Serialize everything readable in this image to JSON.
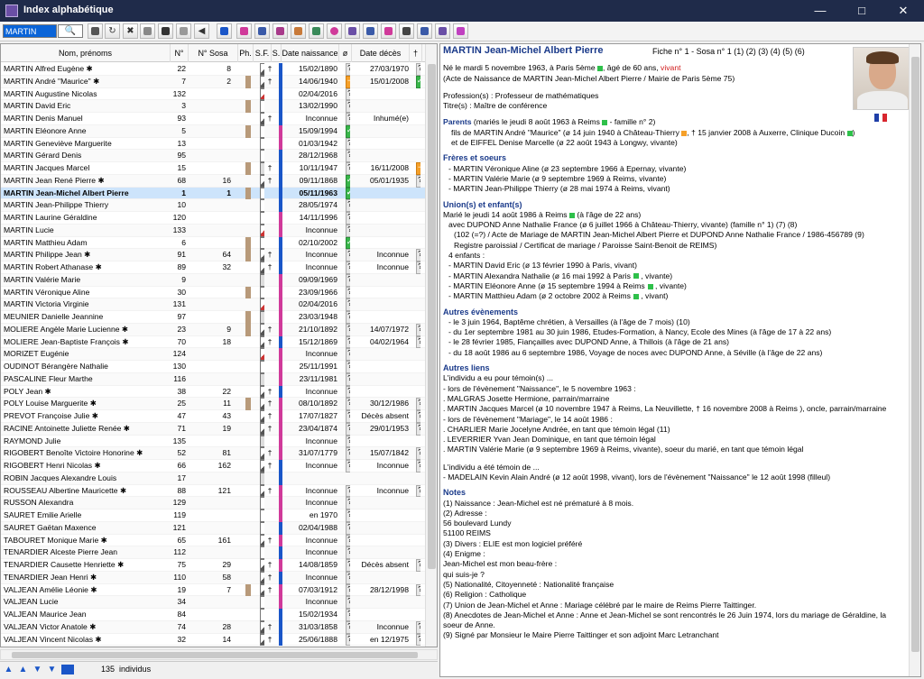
{
  "window": {
    "title": "Index alphabétique",
    "minimize": "—",
    "maximize": "□",
    "close": "✕"
  },
  "search": {
    "value": "MARTIN"
  },
  "columns": {
    "name": "Nom, prénoms",
    "n": "N°",
    "nsosa": "N° Sosa",
    "ph": "Ph.",
    "sf": "S.F.",
    "s": "S.",
    "birth": "Date naissance",
    "q1": "ø",
    "death": "Date décès",
    "q2": "†"
  },
  "rows": [
    {
      "name": "MARTIN Alfred Eugène ✱",
      "n": "22",
      "sosa": "8",
      "ph": false,
      "sf": "g",
      "cr": "†",
      "sx": "m",
      "birth": "15/02/1890",
      "q1": "?",
      "death": "27/03/1970",
      "q2": "?"
    },
    {
      "name": "MARTIN André \"Maurice\" ✱",
      "n": "7",
      "sosa": "2",
      "ph": true,
      "sf": "g",
      "cr": "†",
      "sx": "m",
      "birth": "14/06/1940",
      "q1": "or",
      "death": "15/01/2008",
      "q2": "ok"
    },
    {
      "name": "MARTIN Augustine Nicolas",
      "n": "132",
      "sosa": "",
      "ph": false,
      "sf": "r",
      "cr": "",
      "sx": "m",
      "birth": "02/04/2016",
      "q1": "?",
      "death": "",
      "q2": ""
    },
    {
      "name": "MARTIN David Eric",
      "n": "3",
      "sosa": "",
      "ph": true,
      "sf": "",
      "cr": "",
      "sx": "m",
      "birth": "13/02/1990",
      "q1": "?",
      "death": "",
      "q2": ""
    },
    {
      "name": "MARTIN Denis Manuel",
      "n": "93",
      "sosa": "",
      "ph": false,
      "sf": "g",
      "cr": "†",
      "sx": "m",
      "birth": "Inconnue",
      "q1": "?",
      "death": "Inhumé(e)",
      "q2": ""
    },
    {
      "name": "MARTIN Eléonore Anne",
      "n": "5",
      "sosa": "",
      "ph": true,
      "sf": "",
      "cr": "",
      "sx": "f",
      "birth": "15/09/1994",
      "q1": "ok",
      "death": "",
      "q2": ""
    },
    {
      "name": "MARTIN Geneviève Marguerite",
      "n": "13",
      "sosa": "",
      "ph": false,
      "sf": "",
      "cr": "",
      "sx": "f",
      "birth": "01/03/1942",
      "q1": "?",
      "death": "",
      "q2": ""
    },
    {
      "name": "MARTIN Gérard Denis",
      "n": "95",
      "sosa": "",
      "ph": false,
      "sf": "",
      "cr": "",
      "sx": "m",
      "birth": "28/12/1968",
      "q1": "?",
      "death": "",
      "q2": ""
    },
    {
      "name": "MARTIN Jacques Marcel",
      "n": "15",
      "sosa": "",
      "ph": true,
      "sf": "x",
      "cr": "†",
      "sx": "m",
      "birth": "10/11/1947",
      "q1": "?",
      "death": "16/11/2008",
      "q2": "or"
    },
    {
      "name": "MARTIN Jean René Pierre ✱",
      "n": "68",
      "sosa": "16",
      "ph": false,
      "sf": "g",
      "cr": "†",
      "sx": "m",
      "birth": "09/11/1868",
      "q1": "ok",
      "death": "05/01/1935",
      "q2": "?"
    },
    {
      "name": "MARTIN Jean-Michel Albert Pierre",
      "n": "1",
      "sosa": "1",
      "ph": true,
      "sf": "",
      "cr": "",
      "sx": "m",
      "birth": "05/11/1963",
      "q1": "ok",
      "death": "",
      "q2": "",
      "sel": true
    },
    {
      "name": "MARTIN Jean-Philippe Thierry",
      "n": "10",
      "sosa": "",
      "ph": false,
      "sf": "",
      "cr": "",
      "sx": "m",
      "birth": "28/05/1974",
      "q1": "?",
      "death": "",
      "q2": ""
    },
    {
      "name": "MARTIN Laurine Géraldine",
      "n": "120",
      "sosa": "",
      "ph": false,
      "sf": "",
      "cr": "",
      "sx": "f",
      "birth": "14/11/1996",
      "q1": "?",
      "death": "",
      "q2": ""
    },
    {
      "name": "MARTIN Lucie",
      "n": "133",
      "sosa": "",
      "ph": false,
      "sf": "r",
      "cr": "",
      "sx": "f",
      "birth": "Inconnue",
      "q1": "?",
      "death": "",
      "q2": ""
    },
    {
      "name": "MARTIN Matthieu Adam",
      "n": "6",
      "sosa": "",
      "ph": true,
      "sf": "",
      "cr": "",
      "sx": "m",
      "birth": "02/10/2002",
      "q1": "ok",
      "death": "",
      "q2": ""
    },
    {
      "name": "MARTIN Philippe Jean ✱",
      "n": "91",
      "sosa": "64",
      "ph": true,
      "sf": "g",
      "cr": "†",
      "sx": "m",
      "birth": "Inconnue",
      "q1": "?",
      "death": "Inconnue",
      "q2": "?"
    },
    {
      "name": "MARTIN Robert Athanase ✱",
      "n": "89",
      "sosa": "32",
      "ph": false,
      "sf": "g",
      "cr": "†",
      "sx": "m",
      "birth": "Inconnue",
      "q1": "?",
      "death": "Inconnue",
      "q2": "?"
    },
    {
      "name": "MARTIN Valérie Marie",
      "n": "9",
      "sosa": "",
      "ph": false,
      "sf": "x",
      "cr": "",
      "sx": "f",
      "birth": "09/09/1969",
      "q1": "?",
      "death": "",
      "q2": ""
    },
    {
      "name": "MARTIN Véronique Aline",
      "n": "30",
      "sosa": "",
      "ph": true,
      "sf": "",
      "cr": "",
      "sx": "f",
      "birth": "23/09/1966",
      "q1": "?",
      "death": "",
      "q2": ""
    },
    {
      "name": "MARTIN Victoria Virginie",
      "n": "131",
      "sosa": "",
      "ph": false,
      "sf": "r",
      "cr": "",
      "sx": "f",
      "birth": "02/04/2016",
      "q1": "?",
      "death": "",
      "q2": ""
    },
    {
      "name": "MEUNIER Danielle Jeannine",
      "n": "97",
      "sosa": "",
      "ph": true,
      "sf": "x",
      "cr": "",
      "sx": "f",
      "birth": "23/03/1948",
      "q1": "?",
      "death": "",
      "q2": ""
    },
    {
      "name": "MOLIERE Angèle Marie Lucienne ✱",
      "n": "23",
      "sosa": "9",
      "ph": true,
      "sf": "g",
      "cr": "†",
      "sx": "f",
      "birth": "21/10/1892",
      "q1": "?",
      "death": "14/07/1972",
      "q2": "?"
    },
    {
      "name": "MOLIERE Jean-Baptiste François ✱",
      "n": "70",
      "sosa": "18",
      "ph": false,
      "sf": "g",
      "cr": "†",
      "sx": "m",
      "birth": "15/12/1869",
      "q1": "?",
      "death": "04/02/1964",
      "q2": "?"
    },
    {
      "name": "MORIZET Eugénie",
      "n": "124",
      "sosa": "",
      "ph": false,
      "sf": "r",
      "cr": "",
      "sx": "f",
      "birth": "Inconnue",
      "q1": "?",
      "death": "",
      "q2": ""
    },
    {
      "name": "OUDINOT Bérangère Nathalie",
      "n": "130",
      "sosa": "",
      "ph": false,
      "sf": "",
      "cr": "",
      "sx": "f",
      "birth": "25/11/1991",
      "q1": "?",
      "death": "",
      "q2": ""
    },
    {
      "name": "PASCALINE Fleur Marthe",
      "n": "116",
      "sosa": "",
      "ph": false,
      "sf": "x",
      "cr": "",
      "sx": "f",
      "birth": "23/11/1981",
      "q1": "?",
      "death": "",
      "q2": ""
    },
    {
      "name": "POLY Jean ✱",
      "n": "38",
      "sosa": "22",
      "ph": false,
      "sf": "g",
      "cr": "†",
      "sx": "m",
      "birth": "Inconnue",
      "q1": "?",
      "death": "",
      "q2": ""
    },
    {
      "name": "POLY Louise Marguerite ✱",
      "n": "25",
      "sosa": "11",
      "ph": true,
      "sf": "g",
      "cr": "†",
      "sx": "f",
      "birth": "08/10/1892",
      "q1": "?",
      "death": "30/12/1986",
      "q2": "?"
    },
    {
      "name": "PREVOT Françoise Julie ✱",
      "n": "47",
      "sosa": "43",
      "ph": false,
      "sf": "g",
      "cr": "†",
      "sx": "f",
      "birth": "17/07/1827",
      "q1": "?",
      "death": "Décès absent",
      "q2": "?"
    },
    {
      "name": "RACINE Antoinette Juliette Renée ✱",
      "n": "71",
      "sosa": "19",
      "ph": false,
      "sf": "g",
      "cr": "†",
      "sx": "f",
      "birth": "23/04/1874",
      "q1": "?",
      "death": "29/01/1953",
      "q2": "?"
    },
    {
      "name": "RAYMOND Julie",
      "n": "135",
      "sosa": "",
      "ph": false,
      "sf": "x",
      "cr": "",
      "sx": "f",
      "birth": "Inconnue",
      "q1": "?",
      "death": "",
      "q2": ""
    },
    {
      "name": "RIGOBERT Benoîte Victoire Honorine ✱",
      "n": "52",
      "sosa": "81",
      "ph": false,
      "sf": "g",
      "cr": "†",
      "sx": "f",
      "birth": "31/07/1779",
      "q1": "?",
      "death": "15/07/1842",
      "q2": "?"
    },
    {
      "name": "RIGOBERT Henri Nicolas ✱",
      "n": "66",
      "sosa": "162",
      "ph": false,
      "sf": "g",
      "cr": "†",
      "sx": "m",
      "birth": "Inconnue",
      "q1": "?",
      "death": "Inconnue",
      "q2": "?"
    },
    {
      "name": "ROBIN Jacques Alexandre Louis",
      "n": "17",
      "sosa": "",
      "ph": false,
      "sf": "x",
      "cr": "",
      "sx": "m",
      "birth": "",
      "q1": "",
      "death": "",
      "q2": ""
    },
    {
      "name": "ROUSSEAU Albertine Mauricette ✱",
      "n": "88",
      "sosa": "121",
      "ph": false,
      "sf": "g",
      "cr": "†",
      "sx": "f",
      "birth": "Inconnue",
      "q1": "?",
      "death": "Inconnue",
      "q2": "?"
    },
    {
      "name": "RUSSON Alexandra",
      "n": "129",
      "sosa": "",
      "ph": false,
      "sf": "",
      "cr": "",
      "sx": "f",
      "birth": "Inconnue",
      "q1": "?",
      "death": "",
      "q2": ""
    },
    {
      "name": "SAURET Emilie Arielle",
      "n": "119",
      "sosa": "",
      "ph": false,
      "sf": "",
      "cr": "",
      "sx": "f",
      "birth": "en 1970",
      "q1": "?",
      "death": "",
      "q2": ""
    },
    {
      "name": "SAURET Gaëtan Maxence",
      "n": "121",
      "sosa": "",
      "ph": false,
      "sf": "",
      "cr": "",
      "sx": "m",
      "birth": "02/04/1988",
      "q1": "?",
      "death": "",
      "q2": ""
    },
    {
      "name": "TABOURET Monique Marie ✱",
      "n": "65",
      "sosa": "161",
      "ph": false,
      "sf": "g",
      "cr": "†",
      "sx": "f",
      "birth": "Inconnue",
      "q1": "?",
      "death": "",
      "q2": ""
    },
    {
      "name": "TENARDIER Alceste Pierre Jean",
      "n": "112",
      "sosa": "",
      "ph": false,
      "sf": "",
      "cr": "",
      "sx": "m",
      "birth": "Inconnue",
      "q1": "?",
      "death": "",
      "q2": ""
    },
    {
      "name": "TENARDIER Causette Henriette ✱",
      "n": "75",
      "sosa": "29",
      "ph": false,
      "sf": "g",
      "cr": "†",
      "sx": "f",
      "birth": "14/08/1859",
      "q1": "?",
      "death": "Décès absent",
      "q2": "?"
    },
    {
      "name": "TENARDIER Jean Henri ✱",
      "n": "110",
      "sosa": "58",
      "ph": false,
      "sf": "g",
      "cr": "†",
      "sx": "m",
      "birth": "Inconnue",
      "q1": "?",
      "death": "",
      "q2": ""
    },
    {
      "name": "VALJEAN Amélie Léonie ✱",
      "n": "19",
      "sosa": "7",
      "ph": true,
      "sf": "g",
      "cr": "†",
      "sx": "f",
      "birth": "07/03/1912",
      "q1": "?",
      "death": "28/12/1998",
      "q2": "?"
    },
    {
      "name": "VALJEAN Lucie",
      "n": "34",
      "sosa": "",
      "ph": false,
      "sf": "",
      "cr": "",
      "sx": "f",
      "birth": "Inconnue",
      "q1": "?",
      "death": "",
      "q2": ""
    },
    {
      "name": "VALJEAN Maurice Jean",
      "n": "84",
      "sosa": "",
      "ph": false,
      "sf": "",
      "cr": "",
      "sx": "m",
      "birth": "15/02/1934",
      "q1": "?",
      "death": "",
      "q2": ""
    },
    {
      "name": "VALJEAN Victor Anatole ✱",
      "n": "74",
      "sosa": "28",
      "ph": false,
      "sf": "g",
      "cr": "†",
      "sx": "m",
      "birth": "31/03/1858",
      "q1": "?",
      "death": "Inconnue",
      "q2": "?"
    },
    {
      "name": "VALJEAN Vincent Nicolas ✱",
      "n": "32",
      "sosa": "14",
      "ph": false,
      "sf": "g",
      "cr": "†",
      "sx": "m",
      "birth": "25/06/1888",
      "q1": "?",
      "death": "en 12/1975",
      "q2": "?"
    }
  ],
  "status": {
    "count": "135",
    "label": "individus"
  },
  "fiche": {
    "name": "MARTIN Jean-Michel Albert Pierre",
    "fiche_line": "Fiche n° 1  -  Sosa n° 1     (1) (2) (3) (4) (5) (6)",
    "birth": "Né le mardi 5 novembre 1963, à Paris 5ème",
    "birth_age": ", âgé de 60 ans,",
    "birth_alive": "vivant",
    "birth_acte": "(Acte de Naissance de MARTIN Jean-Michel Albert Pierre / Mairie de Paris 5ème 75)",
    "profession": "Profession(s) : Professeur de mathématiques",
    "titre": "Titre(s) : Maître de conférence",
    "parents_h": "Parents",
    "parents_l1": " (mariés le jeudi 8 août 1963  à Reims",
    "parents_l1b": " - famille n° 2)",
    "parents_l2": "fils de MARTIN André \"Maurice\" (ø 14 juin 1940 à Château-Thierry",
    "parents_l2b": ", † 15 janvier 2008 à Auxerre, Clinique Ducoin",
    "parents_l2c": ")",
    "parents_l3": "et de EIFFEL Denise Marcelle (ø 22 août 1943 à Longwy, vivante)",
    "siblings_h": "Frères et soeurs",
    "siblings": [
      "- MARTIN Véronique Aline (ø 23 septembre 1966 à Epernay, vivante)",
      "- MARTIN Valérie Marie (ø 9 septembre 1969 à Reims, vivante)",
      "- MARTIN Jean-Philippe Thierry (ø 28 mai 1974 à Reims, vivant)"
    ],
    "union_h": "Union(s) et enfant(s)",
    "union_l1": "Marié le jeudi 14 août 1986  à Reims",
    "union_l1b": " (à l'âge de 22 ans)",
    "union_l2": "avec DUPOND Anne Nathalie France (ø 6 juillet 1966 à Château-Thierry, vivante)  (famille n° 1)     (7) (8)",
    "union_l3": "(102 (=?) / Acte de Mariage de MARTIN Jean-Michel Albert Pierre et DUPOND Anne Nathalie France / 1986-456789  (9)",
    "union_l4": "Registre paroissial / Certificat de mariage / Paroisse Saint-Benoit de REIMS)",
    "union_l5": "4 enfants :",
    "children": [
      "- MARTIN David Eric (ø 13 février 1990 à Paris, vivant)",
      "- MARTIN Alexandra Nathalie (ø 16 mai 1992 à Paris",
      "- MARTIN Eléonore Anne (ø 15 septembre 1994 à Reims",
      "- MARTIN Matthieu Adam (ø 2 octobre 2002 à Reims"
    ],
    "children_suffix": [
      "",
      " , vivante)",
      " , vivante)",
      " , vivant)"
    ],
    "events_h": "Autres évènements",
    "events": [
      "- le 3 juin 1964, Baptême chrétien, à Versailles (à l'âge de 7 mois) (10)",
      "- du 1er septembre 1981 au 30 juin 1986, Etudes-Formation, à Nancy, Ecole des Mines (à l'âge de 17 à 22 ans)",
      "- le 28 février 1985, Fiançailles avec DUPOND Anne, à Thillois (à l'âge de 21 ans)",
      "- du 18 août 1986 au 6 septembre 1986, Voyage de noces avec DUPOND Anne, à Séville (à l'âge de 22 ans)"
    ],
    "links_h": "Autres liens",
    "links": [
      "L'individu a eu pour témoin(s) ...",
      "- lors de l'évènement \"Naissance\", le 5 novembre 1963 :",
      ". MALGRAS Josette Hermione, parrain/marraine",
      ". MARTIN Jacques Marcel (ø 10 novembre 1947 à Reims, La Neuvillette,  † 16 novembre 2008 à Reims      ), oncle, parrain/marraine",
      "- lors de l'évènement \"Mariage\", le 14 août 1986 :",
      ". CHARLIER Marie Jocelyne Andrée, en tant que témoin légal (11)",
      ". LEVERRIER Yvan Jean Dominique, en tant que témoin légal",
      ". MARTIN Valérie Marie (ø 9 septembre 1969 à Reims, vivante), soeur du marié, en tant que témoin légal"
    ],
    "links2": [
      "L'individu a été témoin de ...",
      "- MADELAIN Kevin Alain André (ø 12 août 1998, vivant), lors de l'évènement \"Naissance\" le 12 août 1998 (filleul)"
    ],
    "notes_h": "Notes",
    "notes": [
      "(1)  Naissance : Jean-Michel est né prématuré à 8 mois.",
      "(2)  Adresse :",
      "          56 boulevard Lundy",
      "          51100  REIMS",
      "(3)  Divers : ELIE est mon logiciel préféré",
      "(4)  Enigme :",
      "          Jean-Michel est mon beau-frère :",
      "          qui suis-je ?",
      "(5)  Nationalité, Citoyenneté : Nationalité française",
      "(6)  Religion : Catholique",
      "(7)  Union de Jean-Michel et Anne : Mariage célébré par le maire de Reims Pierre Taittinger.",
      "(8)  Anecdotes de Jean-Michel et Anne : Anne et Jean-Michel se sont rencontrés le 26 Juin 1974, lors du mariage de Géraldine, la",
      "       soeur de Anne.",
      "(9)  Signé par Monsieur le Maire Pierre Taittinger et son adjoint Marc Letranchant"
    ]
  }
}
